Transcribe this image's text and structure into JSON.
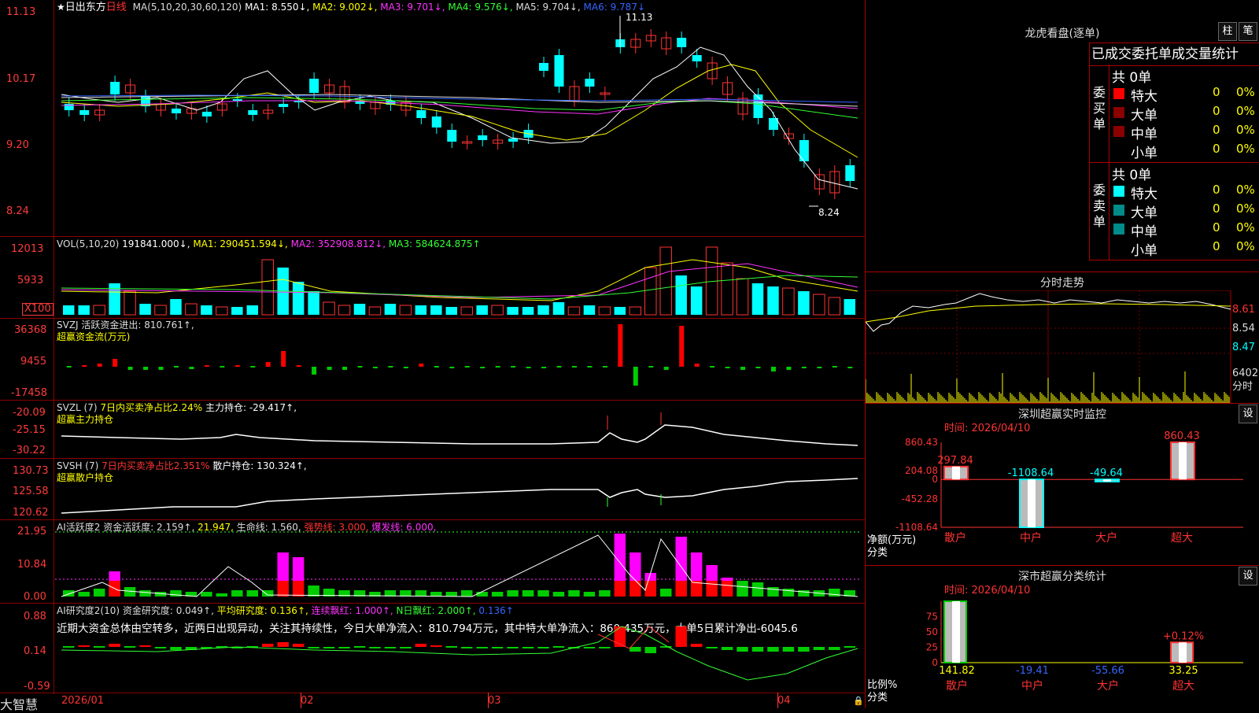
{
  "main_header": {
    "star": "★",
    "stock_name": "日出东方",
    "period": "日线",
    "ma_title": "MA(5,10,20,30,60,120)",
    "items": [
      {
        "text": "MA1: 8.550↓,",
        "color": "#ffffff"
      },
      {
        "text": "MA2: 9.002↓,",
        "color": "#ffff00"
      },
      {
        "text": "MA3: 9.701↓,",
        "color": "#ff33ff"
      },
      {
        "text": "MA4: 9.576↓,",
        "color": "#33ff33"
      },
      {
        "text": "MA5: 9.704↓,",
        "color": "#dddddd"
      },
      {
        "text": "MA6: 9.787↓",
        "color": "#3366ff"
      }
    ],
    "high_mark": "11.13",
    "low_mark": "8.24"
  },
  "price_axis": [
    "11.13",
    "10.17",
    "9.20",
    "8.24"
  ],
  "vol_header": {
    "title": "VOL(5,10,20)",
    "value": "191841.000↓,",
    "items": [
      {
        "text": "MA1: 290451.594↓,",
        "color": "#ffff00"
      },
      {
        "text": "MA2: 352908.812↓,",
        "color": "#ff33ff"
      },
      {
        "text": "MA3: 584624.875↑",
        "color": "#33ff33"
      }
    ],
    "axis": [
      "12013",
      "5933"
    ],
    "unit": "X100"
  },
  "svzj": {
    "line1": "SVZJ  活跃资金进出: 810.761↑,",
    "line2": "超赢资金流(万元)",
    "axis": [
      "36368",
      "9455",
      "-17458"
    ]
  },
  "svzl": {
    "name": "SVZL (7)",
    "pct": "7日内买卖净占比2.24%",
    "hold": "主力持仓: -29.417↑,",
    "line2": "超赢主力持仓",
    "axis": [
      "-20.09",
      "-25.15",
      "-30.22"
    ]
  },
  "svsh": {
    "name": "SVSH (7)",
    "pct": "7日内买卖净占比2.351%",
    "hold": "散户持仓: 130.324↑,",
    "line2": "超赢散户持仓",
    "axis": [
      "130.73",
      "125.58",
      "120.62"
    ]
  },
  "ai_active": {
    "items": [
      {
        "text": "AI活跃度2 资金活跃度: 2.159↑,",
        "color": "#dddddd"
      },
      {
        "text": "21.947,",
        "color": "#ffff00"
      },
      {
        "text": "生命线: 1.560,",
        "color": "#dddddd"
      },
      {
        "text": "强势线: 3.000,",
        "color": "#ff3333"
      },
      {
        "text": "爆发线: 6.000,",
        "color": "#ff33ff"
      }
    ],
    "axis": [
      "21.95",
      "10.84",
      "0.00"
    ]
  },
  "ai_research": {
    "items": [
      {
        "text": "AI研究度2(10) 资金研究度: 0.049↑,",
        "color": "#dddddd"
      },
      {
        "text": "平均研究度: 0.136↑,",
        "color": "#ffff00"
      },
      {
        "text": "连续飘红: 1.000↑,",
        "color": "#ff33ff"
      },
      {
        "text": "N日飘红: 2.000↑,",
        "color": "#33ff33"
      },
      {
        "text": "0.136↑",
        "color": "#3366ff"
      }
    ],
    "comment": "近期大资金总体由空转多，近两日出现异动，关注其持续性，今日大单净流入：810.794万元，其中特大单净流入：860.435万元，大单5日累计净出-6045.6",
    "axis": [
      "0.88",
      "0.14",
      "-0.59"
    ]
  },
  "dates": [
    "2026/01",
    "02",
    "03",
    "04"
  ],
  "brand": "大智慧",
  "lhb": {
    "title": "龙虎看盘(逐单)",
    "btn1": "柱",
    "btn2": "笔",
    "subtitle": "已成交委托单成交量统计",
    "buy_label": "委买单",
    "sell_label": "委卖单",
    "buy_total": "共 0单",
    "sell_total": "共 0单",
    "buy_rows": [
      {
        "name": "特大",
        "qty": "0",
        "pct": "0%",
        "color": "#ff0000"
      },
      {
        "name": "大单",
        "qty": "0",
        "pct": "0%",
        "color": "#8b0000"
      },
      {
        "name": "中单",
        "qty": "0",
        "pct": "0%",
        "color": "#8b0000"
      },
      {
        "name": "小单",
        "qty": "0",
        "pct": "0%",
        "color": ""
      }
    ],
    "sell_rows": [
      {
        "name": "特大",
        "qty": "0",
        "pct": "0%",
        "color": "#00ffff"
      },
      {
        "name": "大单",
        "qty": "0",
        "pct": "0%",
        "color": "#008b8b"
      },
      {
        "name": "中单",
        "qty": "0",
        "pct": "0%",
        "color": "#008b8b"
      },
      {
        "name": "小单",
        "qty": "0",
        "pct": "0%",
        "color": ""
      }
    ]
  },
  "intraday": {
    "title": "分时走势",
    "axis": [
      "8.61",
      "8.54",
      "8.47"
    ],
    "vol_value": "6402",
    "tag": "分时"
  },
  "sz_monitor": {
    "title": "深圳超赢实时监控",
    "btn": "设",
    "time": "时间: 2026/04/10",
    "axis": [
      "860.43",
      "204.08",
      "0",
      "-452.28",
      "-1108.64"
    ],
    "y_label": "净额(万元)",
    "x_label": "分类",
    "categories": [
      "散户",
      "中户",
      "大户",
      "超大"
    ],
    "values": [
      297.84,
      -1108.64,
      -49.64,
      860.43
    ],
    "value_labels": [
      "297.84",
      "-1108.64",
      "-49.64",
      "860.43"
    ]
  },
  "sz_class": {
    "title": "深市超赢分类统计",
    "btn": "设",
    "time": "时间: 2026/04/10",
    "axis": [
      "75",
      "50",
      "25",
      "0"
    ],
    "y_label": "比例%",
    "x_label": "分类",
    "categories": [
      "散户",
      "中户",
      "大户",
      "超大"
    ],
    "top_label": "+0.12%",
    "values": [
      "141.82",
      "-19.41",
      "-55.66",
      "33.25"
    ],
    "value_colors": [
      "#ffff00",
      "#3366ff",
      "#3366ff",
      "#ffff00"
    ]
  }
}
